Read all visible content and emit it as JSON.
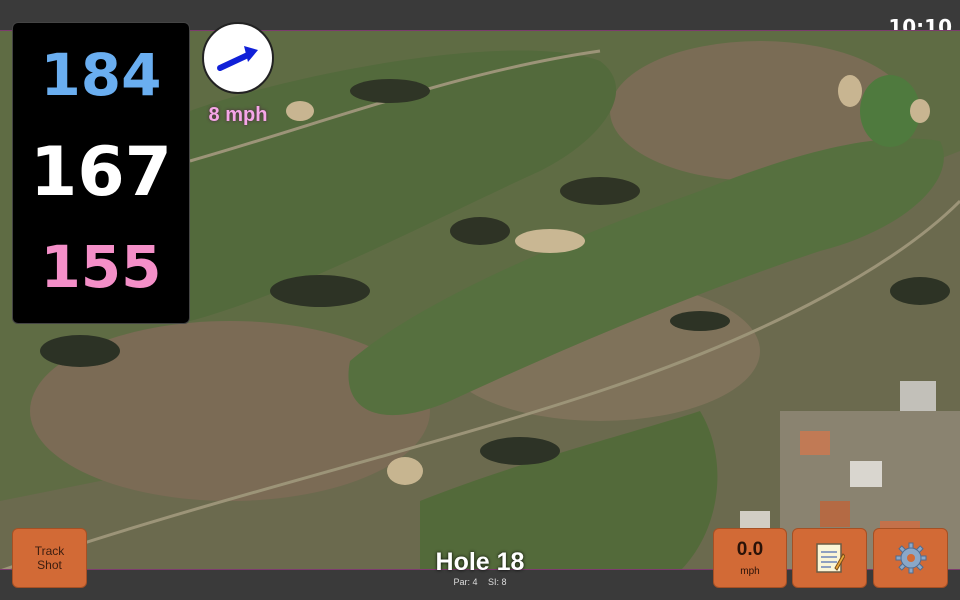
{
  "status": {
    "time": "10:10"
  },
  "distances": {
    "back": "184",
    "middle": "167",
    "front": "155"
  },
  "wind": {
    "speed_label": "8 mph",
    "direction_icon": "wind-arrow-icon"
  },
  "hole": {
    "title": "Hole 18",
    "par": "Par: 4",
    "stroke_index": "SI: 8"
  },
  "buttons": {
    "track_line1": "Track",
    "track_line2": "Shot",
    "speed_value": "0.0",
    "speed_unit": "mph",
    "notes_icon": "notepad-icon",
    "settings_icon": "gear-icon"
  },
  "colors": {
    "back_distance": "#6aaef0",
    "middle_distance": "#ffffff",
    "front_distance": "#f48fc8",
    "button": "#d26a36",
    "accent_border": "#7d3b6e"
  }
}
